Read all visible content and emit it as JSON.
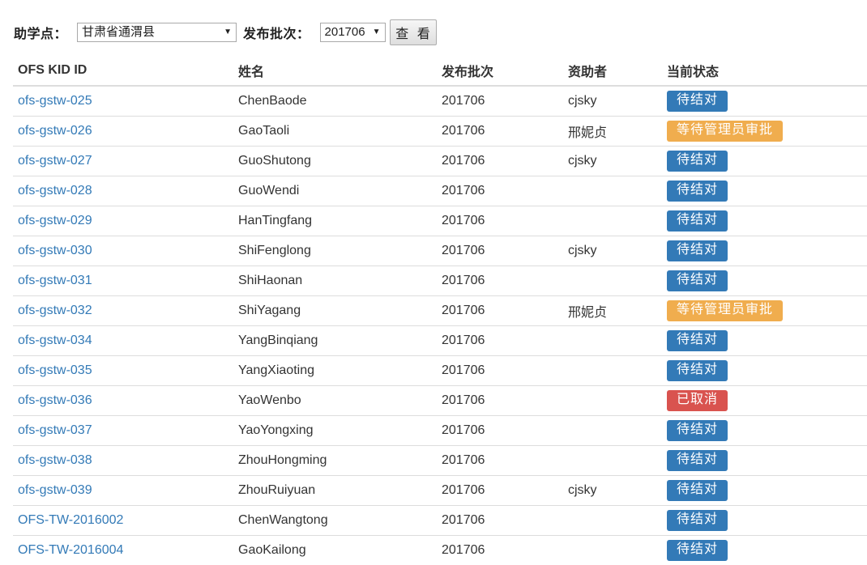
{
  "filters": {
    "site_label": "助学点：",
    "site_value": "甘肃省通渭县",
    "batch_label": "发布批次：",
    "batch_value": "201706",
    "view_button": "查 看"
  },
  "table": {
    "headers": [
      "OFS KID ID",
      "姓名",
      "发布批次",
      "资助者",
      "当前状态"
    ],
    "rows": [
      {
        "id": "ofs-gstw-025",
        "name": "ChenBaode",
        "batch": "201706",
        "sponsor": "cjsky",
        "status": "待结对",
        "status_color": "#337ab7"
      },
      {
        "id": "ofs-gstw-026",
        "name": "GaoTaoli",
        "batch": "201706",
        "sponsor": "邢妮贞",
        "status": "等待管理员审批",
        "status_color": "#f0ad4e"
      },
      {
        "id": "ofs-gstw-027",
        "name": "GuoShutong",
        "batch": "201706",
        "sponsor": "cjsky",
        "status": "待结对",
        "status_color": "#337ab7"
      },
      {
        "id": "ofs-gstw-028",
        "name": "GuoWendi",
        "batch": "201706",
        "sponsor": "",
        "status": "待结对",
        "status_color": "#337ab7"
      },
      {
        "id": "ofs-gstw-029",
        "name": "HanTingfang",
        "batch": "201706",
        "sponsor": "",
        "status": "待结对",
        "status_color": "#337ab7"
      },
      {
        "id": "ofs-gstw-030",
        "name": "ShiFenglong",
        "batch": "201706",
        "sponsor": "cjsky",
        "status": "待结对",
        "status_color": "#337ab7"
      },
      {
        "id": "ofs-gstw-031",
        "name": "ShiHaonan",
        "batch": "201706",
        "sponsor": "",
        "status": "待结对",
        "status_color": "#337ab7"
      },
      {
        "id": "ofs-gstw-032",
        "name": "ShiYagang",
        "batch": "201706",
        "sponsor": "邢妮贞",
        "status": "等待管理员审批",
        "status_color": "#f0ad4e"
      },
      {
        "id": "ofs-gstw-034",
        "name": "YangBinqiang",
        "batch": "201706",
        "sponsor": "",
        "status": "待结对",
        "status_color": "#337ab7"
      },
      {
        "id": "ofs-gstw-035",
        "name": "YangXiaoting",
        "batch": "201706",
        "sponsor": "",
        "status": "待结对",
        "status_color": "#337ab7"
      },
      {
        "id": "ofs-gstw-036",
        "name": "YaoWenbo",
        "batch": "201706",
        "sponsor": "",
        "status": "已取消",
        "status_color": "#d9534f"
      },
      {
        "id": "ofs-gstw-037",
        "name": "YaoYongxing",
        "batch": "201706",
        "sponsor": "",
        "status": "待结对",
        "status_color": "#337ab7"
      },
      {
        "id": "ofs-gstw-038",
        "name": "ZhouHongming",
        "batch": "201706",
        "sponsor": "",
        "status": "待结对",
        "status_color": "#337ab7"
      },
      {
        "id": "ofs-gstw-039",
        "name": "ZhouRuiyuan",
        "batch": "201706",
        "sponsor": "cjsky",
        "status": "待结对",
        "status_color": "#337ab7"
      },
      {
        "id": "OFS-TW-2016002",
        "name": "ChenWangtong",
        "batch": "201706",
        "sponsor": "",
        "status": "待结对",
        "status_color": "#337ab7"
      },
      {
        "id": "OFS-TW-2016004",
        "name": "GaoKailong",
        "batch": "201706",
        "sponsor": "",
        "status": "待结对",
        "status_color": "#337ab7"
      }
    ]
  }
}
